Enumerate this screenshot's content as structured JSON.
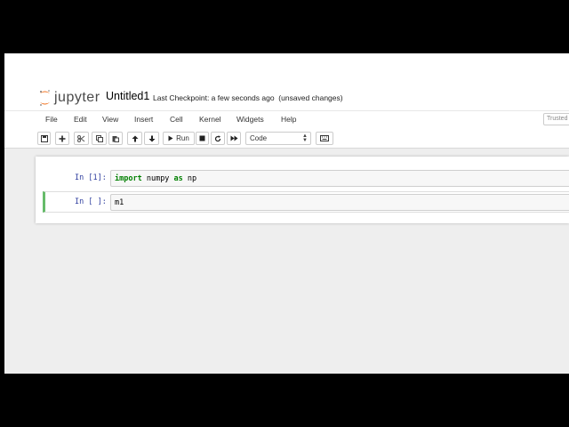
{
  "header": {
    "logo_text": "jupyter",
    "notebook_name": "Untitled1",
    "checkpoint": "Last Checkpoint: a few seconds ago",
    "unsaved": "(unsaved changes)"
  },
  "menu": {
    "items": [
      "File",
      "Edit",
      "View",
      "Insert",
      "Cell",
      "Kernel",
      "Widgets",
      "Help"
    ],
    "trusted": "Trusted"
  },
  "toolbar": {
    "run_label": "Run",
    "cell_type": "Code"
  },
  "cells": [
    {
      "prompt": "In [1]:",
      "code": {
        "kw1": "import",
        "mid": " numpy ",
        "kw2": "as",
        "end": " np"
      }
    },
    {
      "prompt": "In [ ]:",
      "code": {
        "text": "m1"
      }
    }
  ],
  "colors": {
    "accent_selected": "#66bb6a",
    "prompt": "#303f9f",
    "keyword": "#008000",
    "logo_orange": "#f37726"
  }
}
